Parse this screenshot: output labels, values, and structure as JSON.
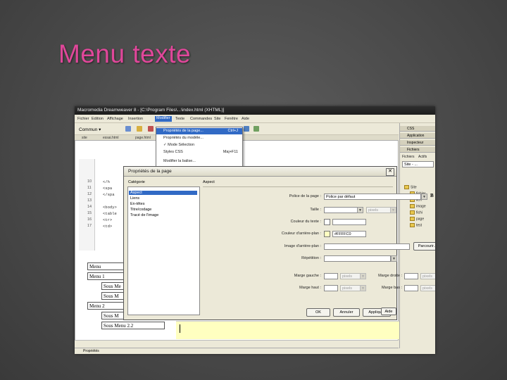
{
  "slide": {
    "title": "Menu texte"
  },
  "app": {
    "title": "Macromedia Dreamweaver 8 - [C:\\Program Files\\...\\index.html (XHTML)]",
    "menus": [
      "Fichier",
      "Edition",
      "Affichage",
      "Insertion",
      "Modifier",
      "Texte",
      "Commandes",
      "Site",
      "Fenêtre",
      "Aide"
    ],
    "active_menu": "Modifier",
    "toolbar_category": "Commun",
    "doc_tabs": [
      "site",
      "essai.html",
      "page.html"
    ]
  },
  "dropdown": {
    "items": [
      {
        "label": "Propriétés de la page...",
        "shortcut": "Ctrl+J",
        "highlighted": true
      },
      {
        "label": "Propriétés du modèle...",
        "shortcut": "",
        "highlighted": false
      },
      {
        "label": "✓ Mode Sélection",
        "shortcut": "",
        "highlighted": false
      },
      {
        "label": "Styles CSS",
        "shortcut": "Maj+F11",
        "highlighted": false
      },
      {
        "label": "Modifier la balise...",
        "shortcut": "",
        "highlighted": false
      }
    ]
  },
  "code": {
    "line_numbers": [
      "10",
      "11",
      "12",
      "13",
      "14",
      "15",
      "16",
      "17"
    ],
    "lines": [
      "</h",
      "<spa",
      "</spa",
      "",
      "<body>",
      "<table",
      "<tr>",
      "<td>"
    ]
  },
  "design_table": {
    "rows": [
      "Menu",
      "Menu 1",
      "Sous Me",
      "Sous M",
      "Menu 2",
      "Sous M",
      "Sous Menu 2.2"
    ]
  },
  "right_panel": {
    "headers": [
      "CSS",
      "Application",
      "Inspecteur",
      "Fichiers"
    ],
    "tabs": [
      "Fichiers",
      "Actifs"
    ],
    "site_select": "Site - ...",
    "tree": [
      "Site",
      "fichier",
      "lien",
      "image",
      "fichi",
      "page",
      "test"
    ]
  },
  "dialog": {
    "title": "Propriétés de la page",
    "close_glyph": "✕",
    "categories_label": "Catégorie",
    "categories": [
      "Aspect",
      "Liens",
      "En-têtes",
      "Titre/codage",
      "Tracé de l'image"
    ],
    "selected_category": "Aspect",
    "panel_label": "Aspect",
    "fields": {
      "page_font": {
        "label": "Police de la page :",
        "value": "Police par défaut"
      },
      "size": {
        "label": "Taille :",
        "value": "",
        "unit": "pixels"
      },
      "text_color": {
        "label": "Couleur du texte :",
        "value": ""
      },
      "bg_color": {
        "label": "Couleur d'arrière-plan :",
        "value": "#FFFFC0",
        "color": "#ffffc0"
      },
      "bg_image": {
        "label": "Image d'arrière-plan :",
        "value": "",
        "button": "Parcourir..."
      },
      "repeat": {
        "label": "Répétition :",
        "value": ""
      },
      "margin_left": {
        "label": "Marge gauche :",
        "unit": "pixels"
      },
      "margin_right": {
        "label": "Marge droite :",
        "unit": "pixels"
      },
      "margin_top": {
        "label": "Marge haut :",
        "unit": "pixels"
      },
      "margin_bottom": {
        "label": "Marge bas :",
        "unit": "pixels"
      }
    },
    "bold_glyph": "B",
    "italic_glyph": "I",
    "buttons": {
      "ok": "OK",
      "cancel": "Annuler",
      "apply": "Appliquer",
      "help": "Aide"
    }
  },
  "bottom_panel_label": "Propriétés",
  "colors": {
    "title_pink": "#e0479a",
    "selection_blue": "#316ac5",
    "yellow_bg": "#ffffc0"
  }
}
